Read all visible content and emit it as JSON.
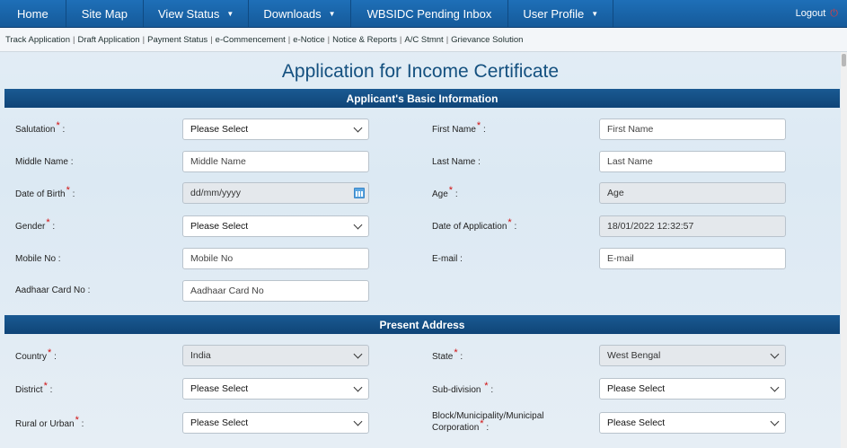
{
  "topnav": {
    "items": [
      {
        "label": "Home"
      },
      {
        "label": "Site Map"
      },
      {
        "label": "View Status"
      },
      {
        "label": "Downloads"
      },
      {
        "label": "WBSIDC Pending Inbox"
      },
      {
        "label": "User Profile"
      }
    ],
    "logout": "Logout"
  },
  "subnav": {
    "items": [
      "Track Application",
      "Draft Application",
      "Payment Status",
      "e-Commencement",
      "e-Notice",
      "Notice & Reports",
      "A/C Stmnt",
      "Grievance Solution"
    ]
  },
  "page": {
    "title": "Application for Income Certificate"
  },
  "sections": {
    "basic": "Applicant's Basic Information",
    "address": "Present Address"
  },
  "fields": {
    "salutation": {
      "label": "Salutation",
      "value": "Please Select"
    },
    "first_name": {
      "label": "First Name",
      "placeholder": "First Name"
    },
    "middle_name": {
      "label": "Middle Name :",
      "placeholder": "Middle Name"
    },
    "last_name": {
      "label": "Last Name :",
      "placeholder": "Last Name"
    },
    "dob": {
      "label": "Date of Birth",
      "placeholder": "dd/mm/yyyy"
    },
    "age": {
      "label": "Age",
      "placeholder": "Age"
    },
    "gender": {
      "label": "Gender",
      "value": "Please Select"
    },
    "date_of_application": {
      "label": "Date of Application",
      "value": "18/01/2022 12:32:57"
    },
    "mobile": {
      "label": "Mobile No :",
      "placeholder": "Mobile No"
    },
    "email": {
      "label": "E-mail :",
      "placeholder": "E-mail"
    },
    "aadhaar": {
      "label": "Aadhaar Card No :",
      "placeholder": "Aadhaar Card No"
    },
    "country": {
      "label": "Country",
      "value": "India"
    },
    "state": {
      "label": "State",
      "value": "West Bengal"
    },
    "district": {
      "label": "District",
      "value": "Please Select"
    },
    "subdivision": {
      "label": "Sub-division",
      "value": "Please Select"
    },
    "rural_urban": {
      "label": "Rural or Urban",
      "value": "Please Select"
    },
    "block": {
      "label_line1": "Block/Municipality/Municipal",
      "label_line2": "Corporation",
      "value": "Please Select"
    }
  },
  "colors": {
    "nav_bg": "#1a64a8",
    "section_bg": "#134c82",
    "title": "#14507f",
    "required": "#d01010"
  }
}
